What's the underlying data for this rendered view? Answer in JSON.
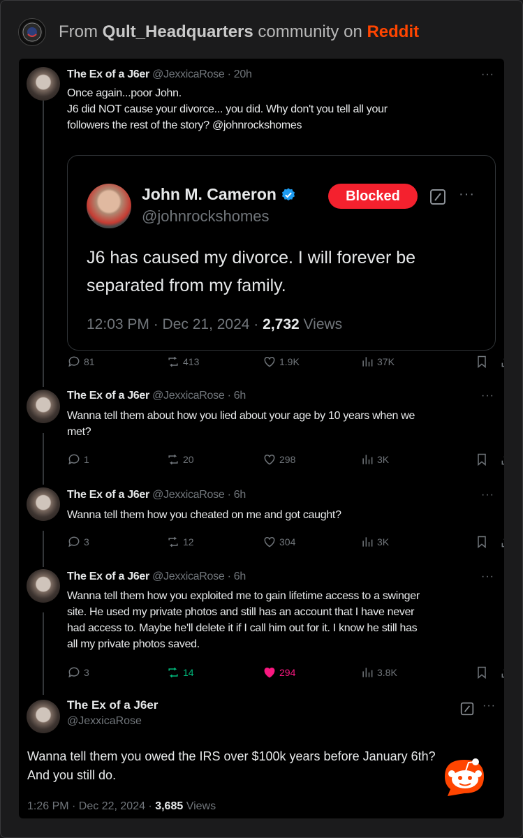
{
  "header": {
    "prefix": "From ",
    "community": "Qult_Headquarters",
    "middle": " community on ",
    "platform": "Reddit",
    "platform_color": "#ff4500"
  },
  "tweets": [
    {
      "name": "The Ex of a J6er",
      "handle": "@JexxicaRose",
      "time": "20h",
      "text_lines": [
        "Once again...poor John.",
        "J6 did NOT cause your divorce... you did. Why don't you tell all your",
        "followers the rest of the story? @johnrockshomes"
      ],
      "replies": "81",
      "retweets": "413",
      "likes": "1.9K",
      "views": "37K"
    },
    {
      "name": "The Ex of a J6er",
      "handle": "@JexxicaRose",
      "time": "6h",
      "text_lines": [
        "Wanna tell them about how you lied about your age by 10 years when we",
        "met?"
      ],
      "replies": "1",
      "retweets": "20",
      "likes": "298",
      "views": "3K"
    },
    {
      "name": "The Ex of a J6er",
      "handle": "@JexxicaRose",
      "time": "6h",
      "text_lines": [
        "Wanna tell them how you cheated on me and got caught?"
      ],
      "replies": "3",
      "retweets": "12",
      "likes": "304",
      "views": "3K"
    },
    {
      "name": "The Ex of a J6er",
      "handle": "@JexxicaRose",
      "time": "6h",
      "text_lines": [
        "Wanna tell them how you exploited me to gain lifetime access to a swinger",
        "site. He used my private photos and still has an account that I have never",
        "had access to. Maybe he'll delete it if I call him out for it. I know he still has",
        "all my private photos saved."
      ],
      "replies": "3",
      "retweets": "14",
      "likes": "294",
      "views": "3.8K"
    }
  ],
  "quoted": {
    "name": "John M. Cameron",
    "handle": "@johnrockshomes",
    "blocked_label": "Blocked",
    "text_lines": [
      "J6 has caused my divorce.  I will forever be",
      "separated from my family."
    ],
    "time": "12:03 PM · Dec 21, 2024 · ",
    "views_count": "2,732",
    "views_label": " Views"
  },
  "main": {
    "name": "The Ex of a J6er",
    "handle": "@JexxicaRose",
    "text_lines": [
      "Wanna tell them you owed the IRS over $100k years before January 6th?",
      "And you still do."
    ],
    "time": "1:26 PM · Dec 22, 2024 · ",
    "views_count": "3,685",
    "views_label": " Views"
  },
  "icons": {
    "reply": "reply-icon",
    "retweet": "retweet-icon",
    "like": "heart-icon",
    "views": "views-icon",
    "bookmark": "bookmark-icon",
    "share": "share-icon",
    "verified": "verified-badge-icon",
    "grok": "grok-icon",
    "snoo": "reddit-snoo-icon"
  },
  "colors": {
    "retweet_active": "#00ba7c",
    "like_active": "#f91880",
    "blocked": "#f4212e",
    "verified": "#1d9bf0"
  }
}
